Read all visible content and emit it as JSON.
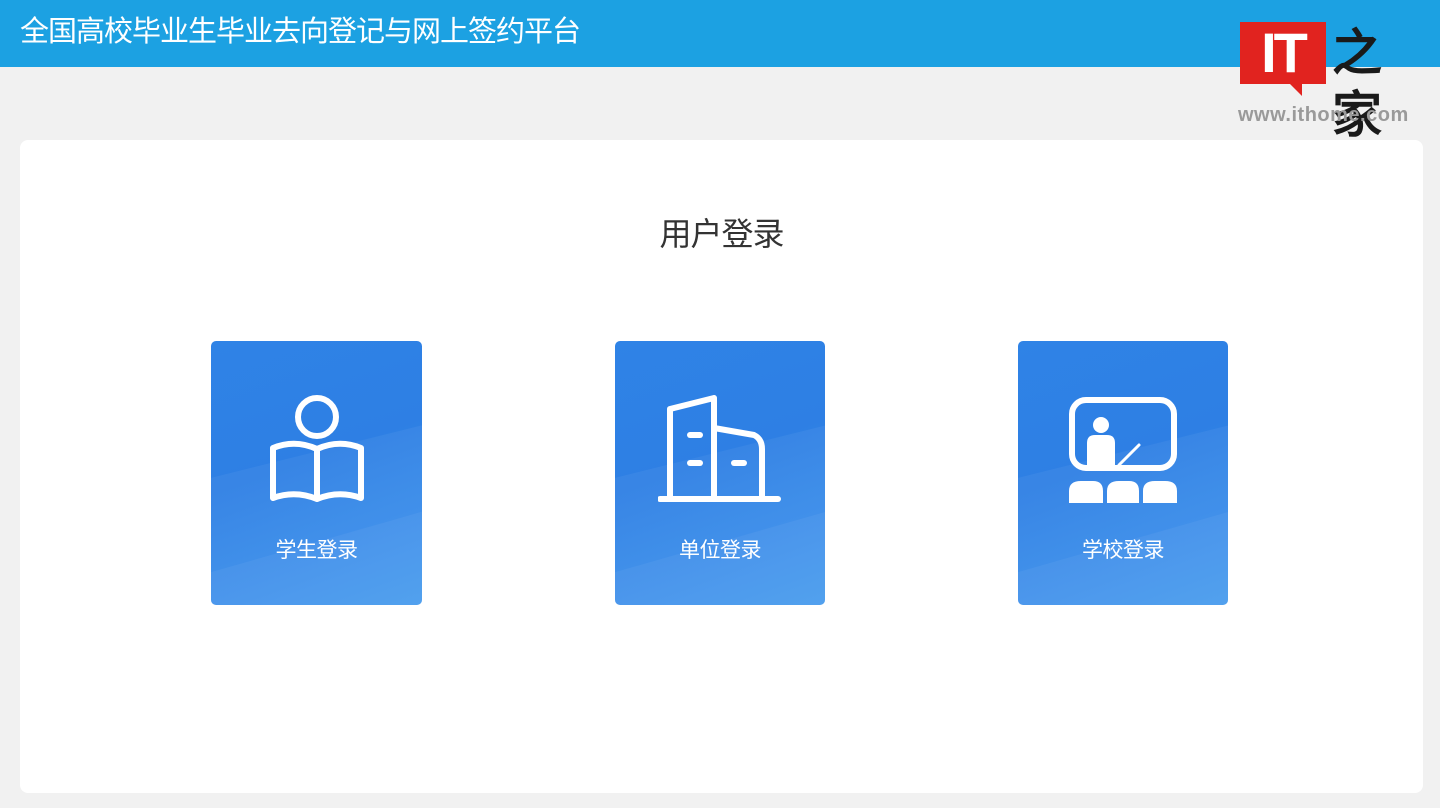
{
  "header": {
    "site_title": "全国高校毕业生毕业去向登记与网上签约平台"
  },
  "watermark": {
    "logo_text": "IT",
    "logo_chinese": "之家",
    "url": "www.ithome.com"
  },
  "login_panel": {
    "title": "用户登录",
    "options": [
      {
        "label": "学生登录",
        "icon": "student-reading-book-icon"
      },
      {
        "label": "单位登录",
        "icon": "office-building-icon"
      },
      {
        "label": "学校登录",
        "icon": "teacher-blackboard-icon"
      }
    ]
  },
  "colors": {
    "header_bg": "#1ca1e2",
    "page_bg": "#f1f1f1",
    "card_bg": "#2f83e6",
    "logo_red": "#e1231f"
  }
}
